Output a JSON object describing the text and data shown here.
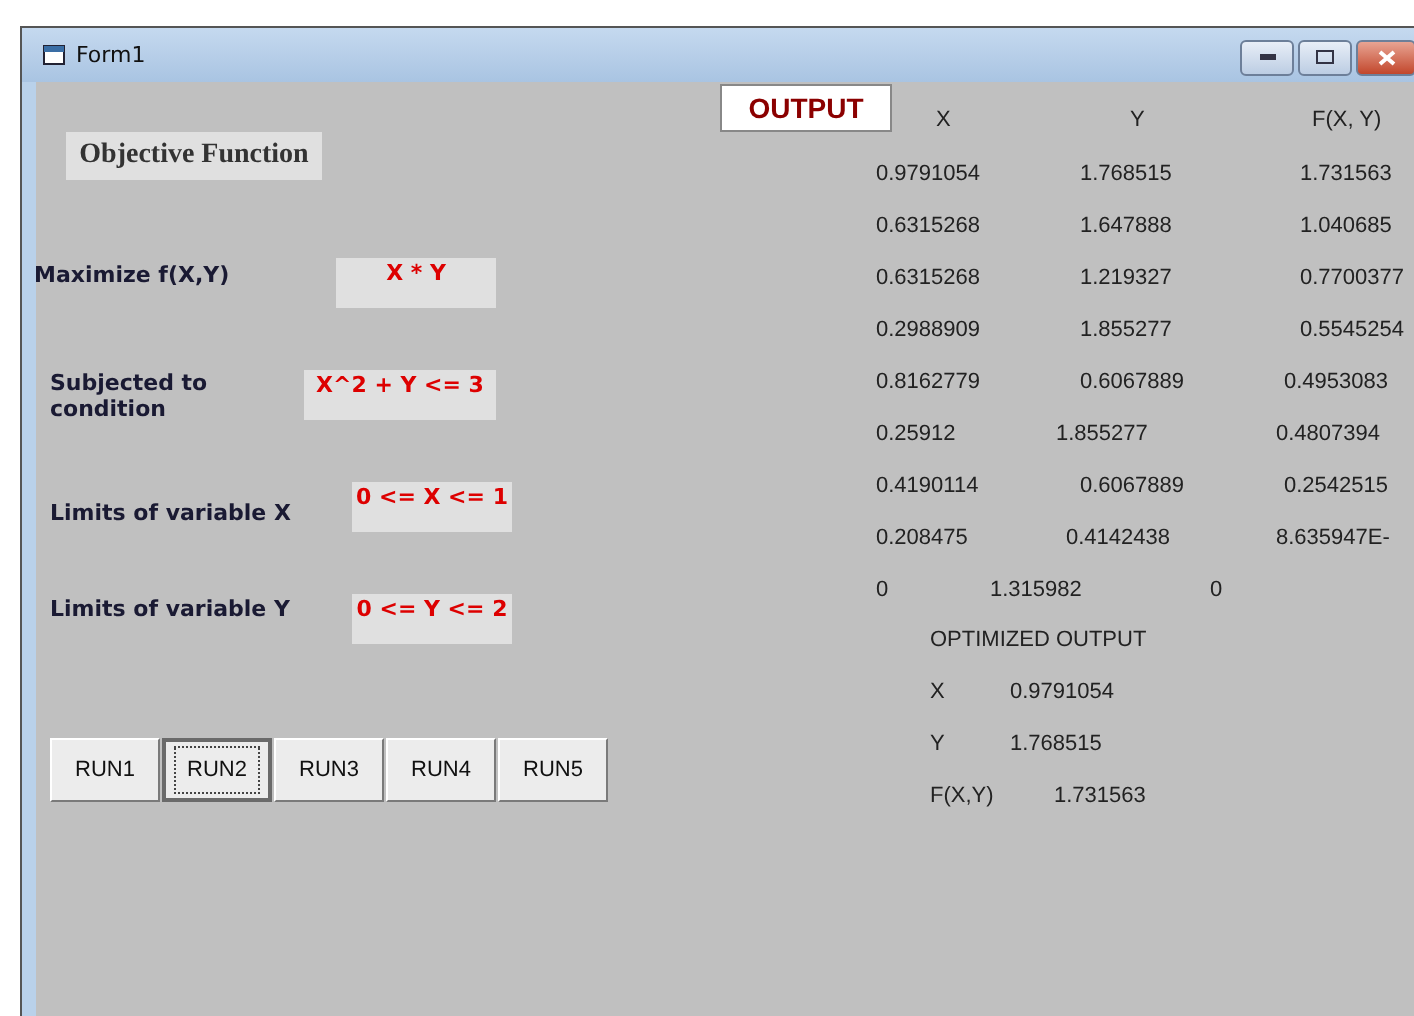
{
  "window": {
    "title": "Form1"
  },
  "inputs": {
    "heading": "Objective Function",
    "fields": [
      {
        "label": "Maximize f(X,Y)",
        "value": "X * Y"
      },
      {
        "label": "Subjected to condition",
        "value": "X^2 + Y <= 3"
      },
      {
        "label": "Limits of variable X",
        "value": "0 <= X <= 1"
      },
      {
        "label": "Limits of variable Y",
        "value": "0 <= Y <= 2"
      }
    ]
  },
  "buttons": [
    {
      "label": "RUN1",
      "selected": false
    },
    {
      "label": "RUN2",
      "selected": true
    },
    {
      "label": "RUN3",
      "selected": false
    },
    {
      "label": "RUN4",
      "selected": false
    },
    {
      "label": "RUN5",
      "selected": false
    }
  ],
  "output": {
    "title": "OUTPUT",
    "columns": [
      "X",
      "Y",
      "F(X, Y)"
    ],
    "rows": [
      [
        "0.9791054",
        "1.768515",
        "1.731563"
      ],
      [
        "0.6315268",
        "1.647888",
        "1.040685"
      ],
      [
        "0.6315268",
        "1.219327",
        "0.7700377"
      ],
      [
        "0.2988909",
        "1.855277",
        "0.5545254"
      ],
      [
        "0.8162779",
        "0.6067889",
        "0.4953083"
      ],
      [
        "0.25912",
        "1.855277",
        "0.4807394"
      ],
      [
        "0.4190114",
        "0.6067889",
        "0.2542515"
      ],
      [
        "0.208475",
        "0.4142438",
        "8.635947E-"
      ],
      [
        "0",
        "1.315982",
        "0"
      ]
    ]
  },
  "optimized": {
    "title": "OPTIMIZED OUTPUT",
    "items": [
      {
        "label": "X",
        "value": "0.9791054"
      },
      {
        "label": "Y",
        "value": "1.768515"
      },
      {
        "label": "F(X,Y)",
        "value": "1.731563"
      }
    ]
  }
}
